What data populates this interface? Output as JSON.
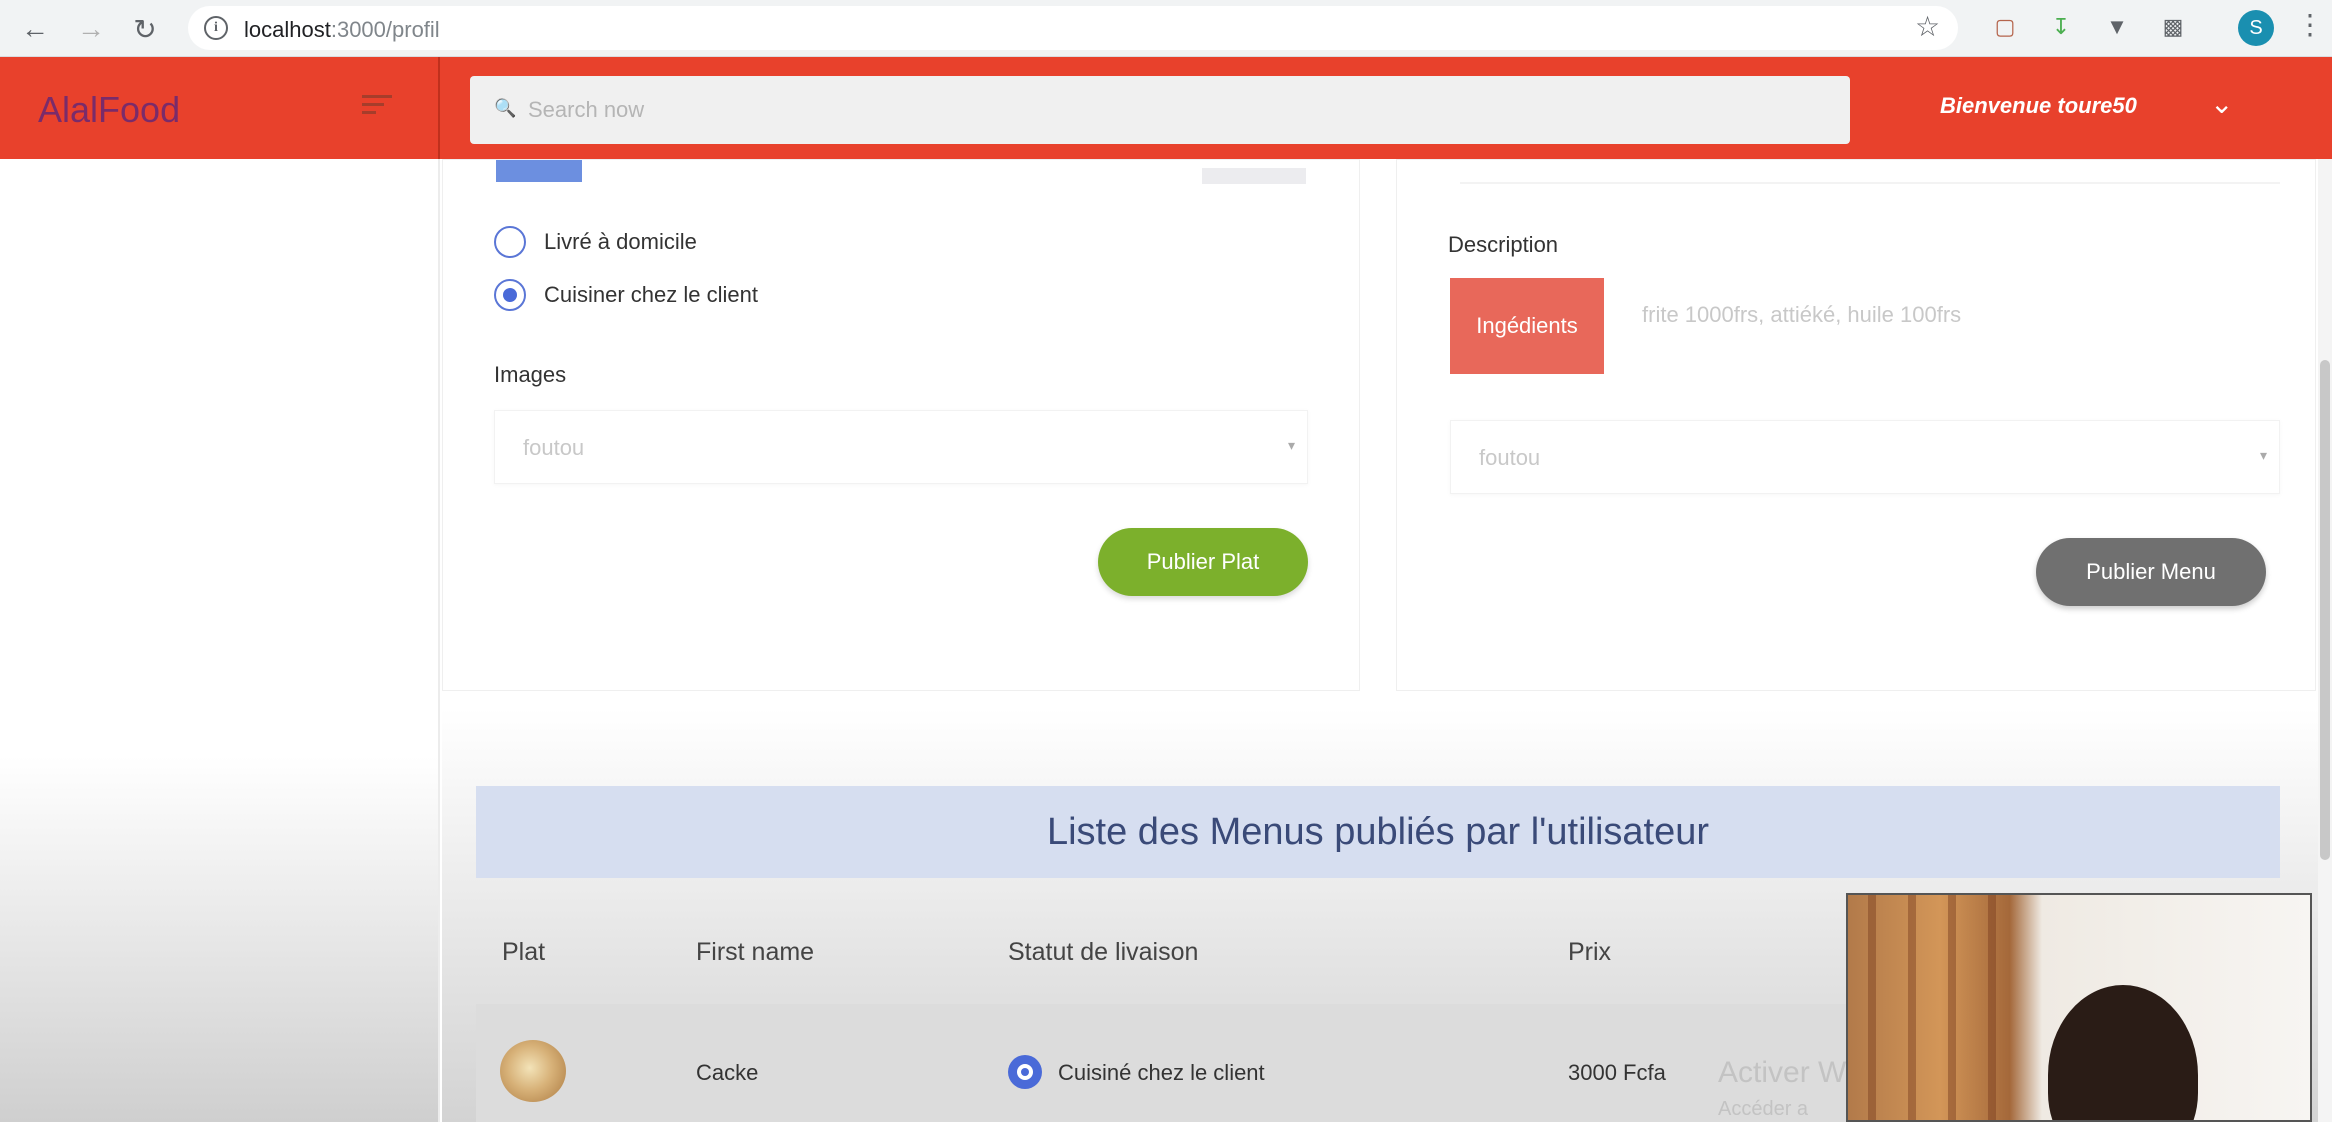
{
  "browser": {
    "url_host": "localhost",
    "url_path": ":3000/profil",
    "profile_initial": "S"
  },
  "header": {
    "brand": "AlalFood",
    "search_placeholder": "Search now",
    "welcome": "Bienvenue toure50",
    "accent_color": "#e8412c"
  },
  "form_left": {
    "delivery_options": [
      {
        "label": "Livré à domicile",
        "checked": false
      },
      {
        "label": "Cuisiner chez le client",
        "checked": true
      }
    ],
    "images_label": "Images",
    "images_select_value": "foutou",
    "submit_label": "Publier Plat"
  },
  "form_right": {
    "description_label": "Description",
    "ingredients_button": "Ingédients",
    "ingredients_placeholder": "frite 1000frs, attiéké, huile 100frs",
    "select_value": "foutou",
    "submit_label": "Publier Menu"
  },
  "menu_list": {
    "title": "Liste des Menus publiés par l'utilisateur",
    "columns": [
      "Plat",
      "First name",
      "Statut de livaison",
      "Prix"
    ],
    "rows": [
      {
        "first_name": "Cacke",
        "status": "Cuisiné chez le client",
        "price": "3000 Fcfa"
      }
    ]
  },
  "overlay": {
    "activate_text": "Activer W",
    "activate_sub": "Accéder a"
  }
}
